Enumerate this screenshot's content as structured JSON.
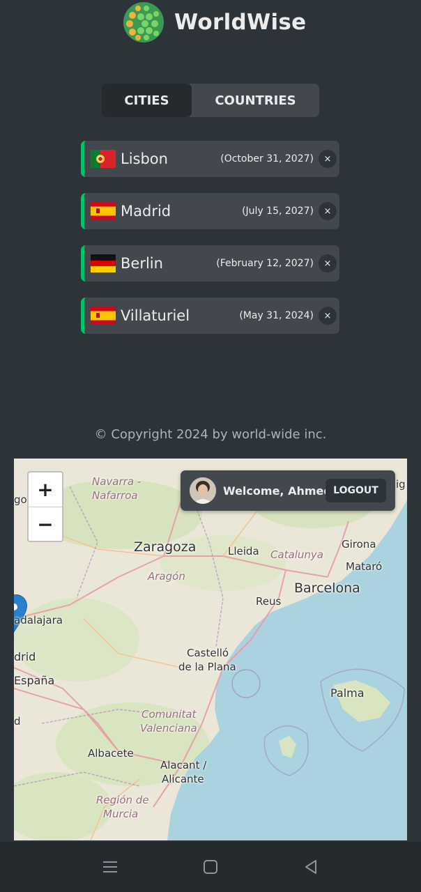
{
  "app": {
    "brand": "WorldWise"
  },
  "tabs": [
    {
      "label": "CITIES",
      "active": true
    },
    {
      "label": "COUNTRIES",
      "active": false
    }
  ],
  "cities": [
    {
      "name": "Lisbon",
      "date": "(October 31, 2027)",
      "flag": "portugal"
    },
    {
      "name": "Madrid",
      "date": "(July 15, 2027)",
      "flag": "spain"
    },
    {
      "name": "Berlin",
      "date": "(February 12, 2027)",
      "flag": "germany"
    },
    {
      "name": "Villaturiel",
      "date": "(May 31, 2024)",
      "flag": "spain"
    }
  ],
  "delete_label": "×",
  "footer": {
    "copyright": "© Copyright 2024 by world-wide inc."
  },
  "map": {
    "zoom_in": "+",
    "zoom_out": "−",
    "user": {
      "welcome": "Welcome, Ahmed",
      "logout": "LOGOUT"
    },
    "labels": {
      "navarra": "Navarra -",
      "nafarroa": "Nafarroa",
      "go": "go",
      "ig": "ig",
      "zaragoza": "Zaragoza",
      "lleida": "Lleida",
      "catalunya": "Catalunya",
      "girona": "Girona",
      "mataro": "Mataró",
      "aragon": "Aragón",
      "barcelona": "Barcelona",
      "reus": "Reus",
      "guadalajara": "adalajara",
      "madrid": "drid",
      "espana": "España",
      "castello": "Castelló",
      "plana": "de la Plana",
      "palma": "Palma",
      "d": "d",
      "comunitat": "Comunitat",
      "valenciana": "Valenciana",
      "albacete": "Albacete",
      "alacant": "Alacant /",
      "alicante": "Alicante",
      "region": "Región de",
      "murcia": "Murcia"
    }
  },
  "colors": {
    "accent": "#00c46a",
    "background": "#2d3439",
    "panel": "#42484d"
  }
}
